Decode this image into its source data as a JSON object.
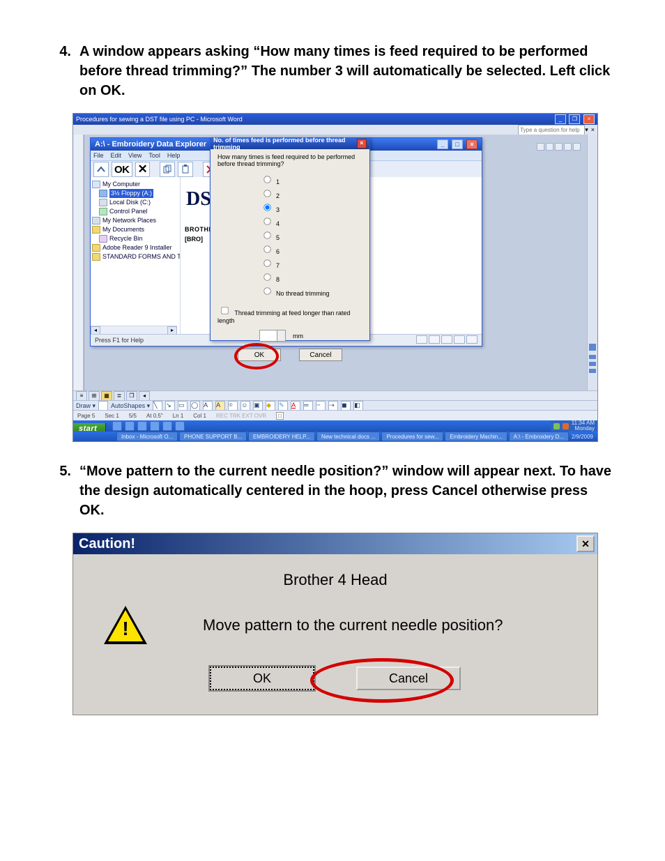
{
  "steps": {
    "s4_num": "4.",
    "s4_text": "A window appears asking “How many times is feed required to be performed before thread trimming?” The number 3 will automatically be selected. Left click on OK.",
    "s5_num": "5.",
    "s5_text": "“Move pattern to the current needle position?” window will appear next. To have the design automatically centered in the hoop, press Cancel otherwise press OK."
  },
  "shot1": {
    "word_title": "Procedures for sewing a DST file using PC - Microsoft Word",
    "help_placeholder": "Type a question for help",
    "explorer": {
      "title": "A:\\ - Embroidery Data Explorer",
      "menu": [
        "File",
        "Edit",
        "View",
        "Tool",
        "Help"
      ],
      "tree": [
        "My Computer",
        "3½ Floppy (A:)",
        "Local Disk (C:)",
        "Control Panel",
        "My Network Places",
        "My Documents",
        "Recycle Bin",
        "Adobe Reader 9 Installer",
        "STANDARD FORMS AND TEMPLAT"
      ],
      "preview_big": "DS",
      "preview_l1": "BROTHER",
      "preview_l2": "[BRO]",
      "status": "Press F1 for Help"
    },
    "dialog": {
      "title": "No. of times feed is performed before thread trimming",
      "question": "How many times is feed required to be performed before thread trimming?",
      "options": [
        "1",
        "2",
        "3",
        "4",
        "5",
        "6",
        "7",
        "8",
        "No thread trimming"
      ],
      "selected_index": 2,
      "checkbox_label": "Thread trimming at feed longer than rated length",
      "mm_label": "mm",
      "ok": "OK",
      "cancel": "Cancel"
    },
    "draw_label": "Draw ▾",
    "autoshapes_label": "AutoShapes ▾",
    "status_cells": [
      "Page 5",
      "Sec 1",
      "5/5",
      "At 0.5\"",
      "Ln 1",
      "Col 1"
    ],
    "status_modes": "REC TRK EXT OVR",
    "start_label": "start",
    "taskbar_items": [
      "Inbox - Microsoft O...",
      "PHONE SUPPORT B...",
      "EMBROIDERY HELP...",
      "New technical docs ...",
      "Procedures for sew...",
      "Embroidery Machin...",
      "A:\\ - Embroidery D..."
    ],
    "time1": "11:34 AM",
    "day": "Monday",
    "date": "2/9/2009"
  },
  "shot2": {
    "title": "Caution!",
    "heading": "Brother 4 Head",
    "question": "Move pattern to the current needle position?",
    "ok": "OK",
    "cancel": "Cancel"
  }
}
